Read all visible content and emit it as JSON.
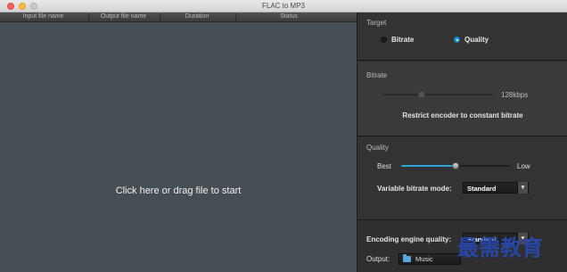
{
  "window": {
    "title": "FLAC to MP3"
  },
  "file_list": {
    "columns": [
      "Input file name",
      "Output file name",
      "Duration",
      "Status"
    ],
    "drop_text": "Click here or drag file to start"
  },
  "target": {
    "title": "Target",
    "options": [
      {
        "label": "Bitrate",
        "selected": false
      },
      {
        "label": "Quality",
        "selected": true
      }
    ]
  },
  "bitrate": {
    "title": "Bitrate",
    "value_label": "128kbps",
    "restrict_label": "Restrict encoder to constant bitrate"
  },
  "quality": {
    "title": "Quality",
    "best_label": "Best",
    "low_label": "Low",
    "level": 0.5,
    "vbr_mode_label": "Variable bitrate mode:",
    "vbr_mode_value": "Standard"
  },
  "engine": {
    "label": "Encoding engine quality:",
    "value": "Standard",
    "output_label": "Output:",
    "output_value": "Music"
  },
  "watermark": "最需教育",
  "colors": {
    "accent": "#1e9bd7",
    "list_bg": "#464e55",
    "panel_bg": "#2e2e2e"
  },
  "icons": [
    "close-icon",
    "minimize-icon",
    "maximize-icon",
    "folder-icon",
    "chevron-down-icon"
  ]
}
